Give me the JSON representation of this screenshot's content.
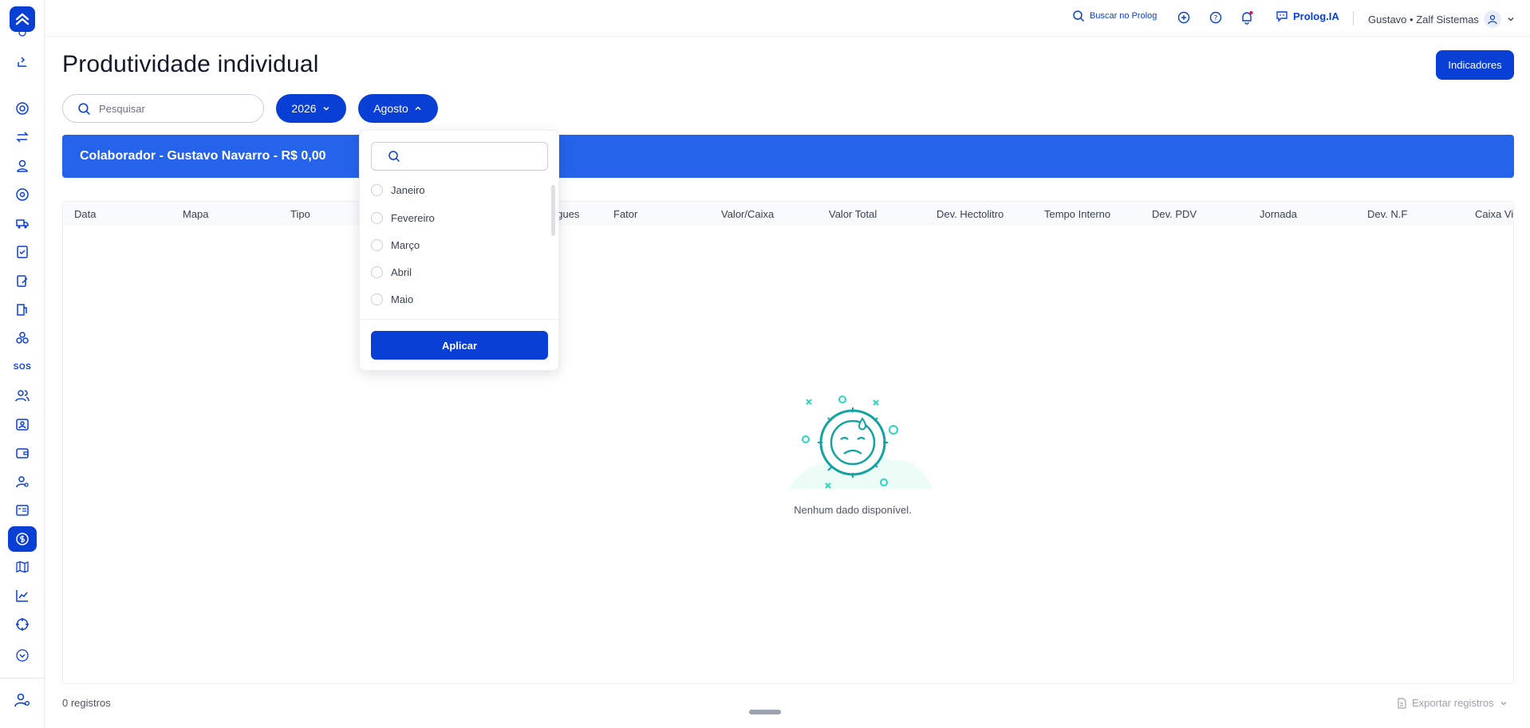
{
  "topbar": {
    "search_label": "Buscar no Prolog",
    "ai_label": "Prolog.IA",
    "user_label": "Gustavo • Zalf Sistemas"
  },
  "sidebar": {
    "sos_label": "SOS"
  },
  "page": {
    "title": "Produtividade individual",
    "indicators_button": "Indicadores"
  },
  "filters": {
    "search_placeholder": "Pesquisar",
    "year": "2026",
    "month": "Agosto"
  },
  "banner": {
    "text": "Colaborador - Gustavo Navarro - R$ 0,00"
  },
  "table": {
    "columns": [
      "Data",
      "Mapa",
      "Tipo",
      "egues",
      "Fator",
      "Valor/Caixa",
      "Valor Total",
      "Dev. Hectolitro",
      "Tempo Interno",
      "Dev. PDV",
      "Jornada",
      "Dev. N.F",
      "Caixa Vi"
    ],
    "empty_text": "Nenhum dado disponível."
  },
  "footer": {
    "count": "0 registros",
    "export_label": "Exportar registros"
  },
  "dropdown": {
    "search_value": "",
    "months": [
      "Janeiro",
      "Fevereiro",
      "Março",
      "Abril",
      "Maio"
    ],
    "apply_label": "Aplicar"
  }
}
